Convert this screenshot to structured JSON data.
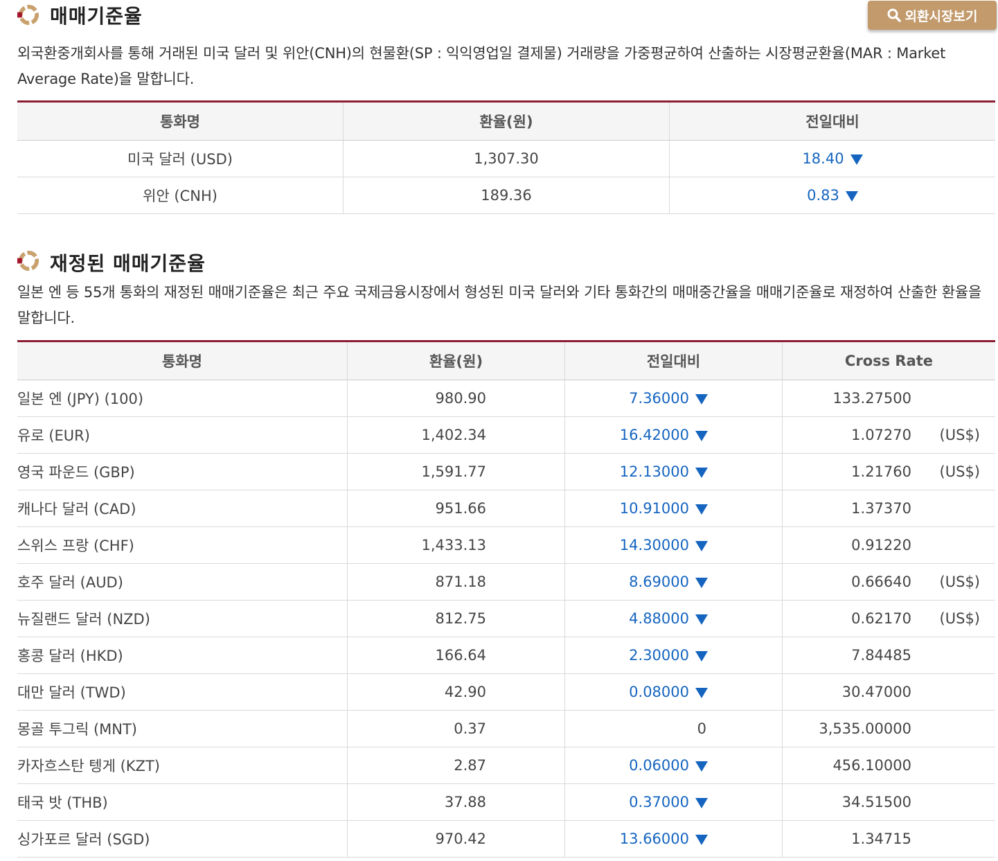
{
  "section1": {
    "title": "매매기준율",
    "button_label": "외환시장보기",
    "description": "외국환중개회사를 통해 거래된 미국 달러 및 위안(CNH)의 현물환(SP : 익익영업일 결제물) 거래량을 가중평균하여 산출하는 시장평균환율(MAR : Market Average Rate)을 말합니다.",
    "headers": [
      "통화명",
      "환율(원)",
      "전일대비"
    ],
    "rows": [
      {
        "currency": "미국 달러 (USD)",
        "rate": "1,307.30",
        "change": "18.40",
        "direction": "down"
      },
      {
        "currency": "위안 (CNH)",
        "rate": "189.36",
        "change": "0.83",
        "direction": "down"
      }
    ]
  },
  "section2": {
    "title": "재정된 매매기준율",
    "description": "일본 엔 등 55개 통화의 재정된 매매기준율은 최근 주요 국제금융시장에서 형성된 미국 달러와 기타 통화간의 매매중간율을 매매기준율로 재정하여 산출한 환율을 말합니다.",
    "headers": [
      "통화명",
      "환율(원)",
      "전일대비",
      "Cross Rate"
    ],
    "rows": [
      {
        "currency": "일본 엔 (JPY) (100)",
        "rate": "980.90",
        "change": "7.36000",
        "direction": "down",
        "cross": "133.27500",
        "unit": ""
      },
      {
        "currency": "유로 (EUR)",
        "rate": "1,402.34",
        "change": "16.42000",
        "direction": "down",
        "cross": "1.07270",
        "unit": "(US$)"
      },
      {
        "currency": "영국 파운드 (GBP)",
        "rate": "1,591.77",
        "change": "12.13000",
        "direction": "down",
        "cross": "1.21760",
        "unit": "(US$)"
      },
      {
        "currency": "캐나다 달러 (CAD)",
        "rate": "951.66",
        "change": "10.91000",
        "direction": "down",
        "cross": "1.37370",
        "unit": ""
      },
      {
        "currency": "스위스 프랑 (CHF)",
        "rate": "1,433.13",
        "change": "14.30000",
        "direction": "down",
        "cross": "0.91220",
        "unit": ""
      },
      {
        "currency": "호주 달러 (AUD)",
        "rate": "871.18",
        "change": "8.69000",
        "direction": "down",
        "cross": "0.66640",
        "unit": "(US$)"
      },
      {
        "currency": "뉴질랜드 달러 (NZD)",
        "rate": "812.75",
        "change": "4.88000",
        "direction": "down",
        "cross": "0.62170",
        "unit": "(US$)"
      },
      {
        "currency": "홍콩 달러 (HKD)",
        "rate": "166.64",
        "change": "2.30000",
        "direction": "down",
        "cross": "7.84485",
        "unit": ""
      },
      {
        "currency": "대만 달러 (TWD)",
        "rate": "42.90",
        "change": "0.08000",
        "direction": "down",
        "cross": "30.47000",
        "unit": ""
      },
      {
        "currency": "몽골 투그릭 (MNT)",
        "rate": "0.37",
        "change": "0",
        "direction": "none",
        "cross": "3,535.00000",
        "unit": ""
      },
      {
        "currency": "카자흐스탄 텡게 (KZT)",
        "rate": "2.87",
        "change": "0.06000",
        "direction": "down",
        "cross": "456.10000",
        "unit": ""
      },
      {
        "currency": "태국 밧 (THB)",
        "rate": "37.88",
        "change": "0.37000",
        "direction": "down",
        "cross": "34.51500",
        "unit": ""
      },
      {
        "currency": "싱가포르 달러 (SGD)",
        "rate": "970.42",
        "change": "13.66000",
        "direction": "down",
        "cross": "1.34715",
        "unit": ""
      }
    ]
  },
  "icons": {
    "section_icon": "ring-bullet-icon",
    "button_icon": "search-icon",
    "down_icon": "triangle-down-icon"
  },
  "colors": {
    "accent_border": "#8b1c32",
    "button_bg": "#c29a6c",
    "change_down": "#1565c0",
    "icon_red": "#a3162c",
    "icon_gold": "#c9a16e"
  }
}
